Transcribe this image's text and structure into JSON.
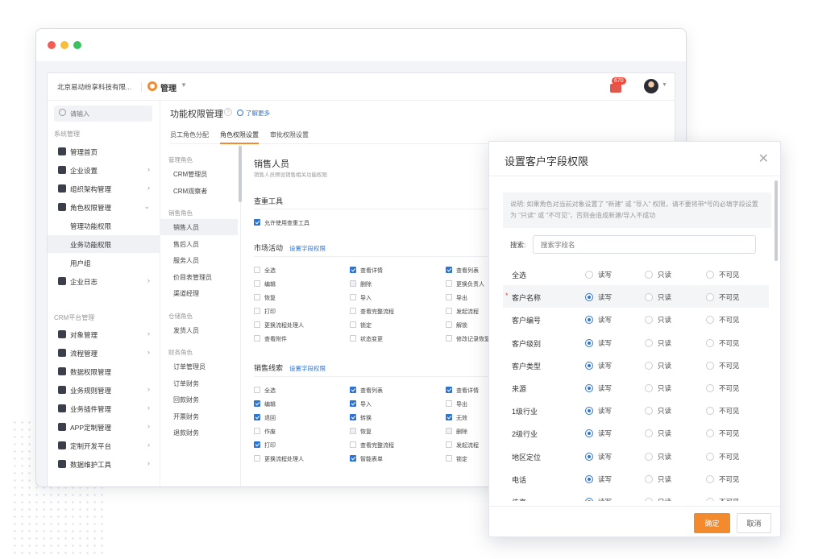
{
  "header": {
    "company": "北京易动纷享科技有限...",
    "module_label": "管理",
    "notif_count": "670"
  },
  "sidebar": {
    "search_placeholder": "请输入",
    "section1": "系统管理",
    "items1": [
      "管理首页",
      "企业设置",
      "组织架构管理",
      "角色权限管理"
    ],
    "sub_items": [
      "管理功能权限",
      "业务功能权限",
      "用户组"
    ],
    "item_log": "企业日志",
    "section2": "CRM平台管理",
    "items2": [
      "对象管理",
      "流程管理",
      "数据权限管理",
      "业务规则管理",
      "业务插件管理",
      "APP定制管理",
      "定制开发平台",
      "数据维护工具"
    ]
  },
  "main": {
    "title": "功能权限管理",
    "learn_more": "了解更多",
    "tabs": [
      "员工角色分配",
      "角色权限设置",
      "审批权限设置"
    ],
    "role_groups": [
      {
        "title": "管理角色",
        "items": [
          "CRM管理员",
          "CRM观察者"
        ]
      },
      {
        "title": "销售角色",
        "items": [
          "销售人员",
          "售后人员",
          "服务人员",
          "价目表管理员",
          "渠道经理"
        ]
      },
      {
        "title": "仓储角色",
        "items": [
          "发货人员"
        ]
      },
      {
        "title": "财务角色",
        "items": [
          "订单管理员",
          "订单财务",
          "回款财务",
          "开票财务",
          "退款财务"
        ]
      }
    ],
    "content": {
      "role_title": "销售人员",
      "role_desc": "销售人员预设销售相关功能权限",
      "dup_tool_title": "查重工具",
      "dup_tool_opt": "允许使用查重工具",
      "field_perm_link": "设置字段权限",
      "sec_market": "市场活动",
      "market_opts": [
        [
          "全选",
          "查看详情",
          "查看列表"
        ],
        [
          "编辑",
          "删除",
          "更换负责人"
        ],
        [
          "恢复",
          "导入",
          "导出"
        ],
        [
          "打印",
          "查看完整流程",
          "发起流程"
        ],
        [
          "更换流程处理人",
          "锁定",
          "解锁"
        ],
        [
          "查看附件",
          "状态变更",
          "修改记录恢复"
        ]
      ],
      "sec_leads": "销售线索",
      "leads_opts": [
        [
          "全选",
          "查看列表",
          "查看详情"
        ],
        [
          "编辑",
          "导入",
          "导出"
        ],
        [
          "退回",
          "转换",
          "无效"
        ],
        [
          "作废",
          "恢复",
          "删除"
        ],
        [
          "打印",
          "查看完整流程",
          "发起流程"
        ],
        [
          "更换流程处理人",
          "智能表单",
          "锁定"
        ]
      ]
    }
  },
  "modal": {
    "title": "设置客户字段权限",
    "note": "说明: 如果角色对当前对象设置了 \"新建\" 或 \"导入\" 权限，请不要将带*号的必填字段设置为 \"只读\" 或 \"不可见\"，否则会造成新建/导入不成功",
    "search_label": "搜索:",
    "search_placeholder": "搜索字段名",
    "options": [
      "读写",
      "只读",
      "不可见"
    ],
    "rows": [
      {
        "name": "全选",
        "required": false,
        "sel": null,
        "highlight": false
      },
      {
        "name": "客户名称",
        "required": true,
        "sel": 0,
        "highlight": true
      },
      {
        "name": "客户编号",
        "required": false,
        "sel": 0,
        "highlight": false
      },
      {
        "name": "客户级别",
        "required": false,
        "sel": 0,
        "highlight": false
      },
      {
        "name": "客户类型",
        "required": false,
        "sel": 0,
        "highlight": false
      },
      {
        "name": "来源",
        "required": false,
        "sel": 0,
        "highlight": false
      },
      {
        "name": "1级行业",
        "required": false,
        "sel": 0,
        "highlight": false
      },
      {
        "name": "2级行业",
        "required": false,
        "sel": 0,
        "highlight": false
      },
      {
        "name": "地区定位",
        "required": false,
        "sel": 0,
        "highlight": false
      },
      {
        "name": "电话",
        "required": false,
        "sel": 0,
        "highlight": false
      },
      {
        "name": "传真",
        "required": false,
        "sel": 0,
        "highlight": false
      }
    ],
    "ok": "确定",
    "cancel": "取消"
  }
}
